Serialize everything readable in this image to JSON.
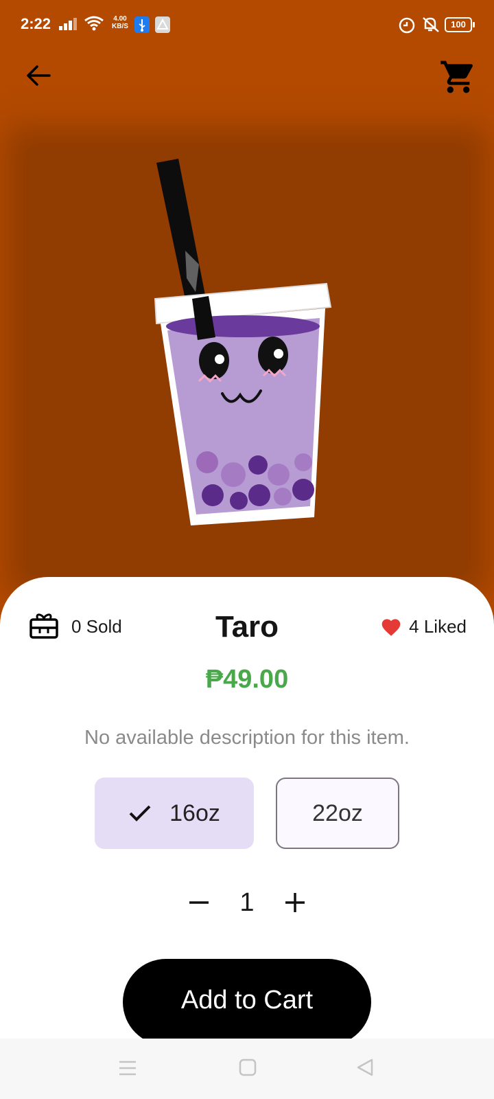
{
  "status_bar": {
    "time": "2:22",
    "net_speed_value": "4.00",
    "net_speed_unit": "KB/S",
    "battery": "100",
    "icons": [
      "signal-icon",
      "wifi-icon",
      "usb-icon",
      "app-icon",
      "alarm-icon",
      "mute-icon",
      "battery-icon"
    ]
  },
  "header": {
    "icons": [
      "back-arrow-icon",
      "cart-icon"
    ]
  },
  "product": {
    "name": "Taro",
    "sold": "0 Sold",
    "liked": "4 Liked",
    "price": "₱49.00",
    "description": "No available description for this item.",
    "image_icon": "taro-milk-tea-illustration"
  },
  "sizes": {
    "selected": "16oz",
    "options": [
      "16oz",
      "22oz"
    ]
  },
  "quantity": {
    "value": "1",
    "icons": [
      "minus-icon",
      "plus-icon"
    ]
  },
  "actions": {
    "add_to_cart": "Add to Cart"
  },
  "colors": {
    "background": "#b34a00",
    "price": "#49a84a",
    "selected_chip": "#e5dcf6",
    "heart": "#e53935",
    "button": "#000000"
  }
}
